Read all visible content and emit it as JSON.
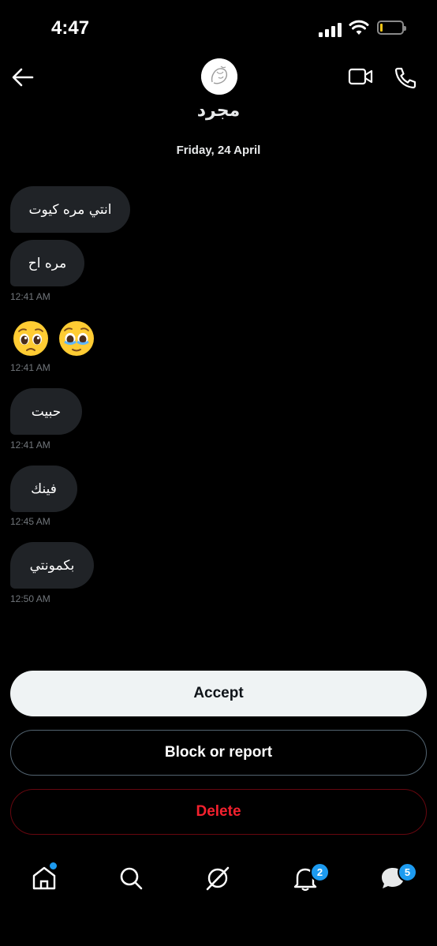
{
  "status_bar": {
    "time": "4:47"
  },
  "header": {
    "contact_name": "مجرد",
    "date": "Friday, 24 April"
  },
  "messages": [
    {
      "text": "انتي مره كيوت"
    },
    {
      "text": "مره اح",
      "time": "12:41 AM"
    },
    {
      "emojis": [
        "pleading-face",
        "face-holding-back-tears"
      ],
      "time": "12:41 AM"
    },
    {
      "text": "حبيت",
      "time": "12:41 AM"
    },
    {
      "text": "فينك",
      "time": "12:45 AM"
    },
    {
      "text": "بكمونتي",
      "time": "12:50 AM"
    }
  ],
  "actions": {
    "accept": "Accept",
    "block": "Block or report",
    "delete": "Delete"
  },
  "nav": {
    "items": [
      "home-icon",
      "search-icon",
      "grok-icon",
      "notifications-icon",
      "messages-icon"
    ],
    "notifications_badge": "2",
    "messages_badge": "5"
  },
  "colors": {
    "accent": "#1d9bf0",
    "danger": "#f4212e",
    "bubble": "#202327"
  }
}
